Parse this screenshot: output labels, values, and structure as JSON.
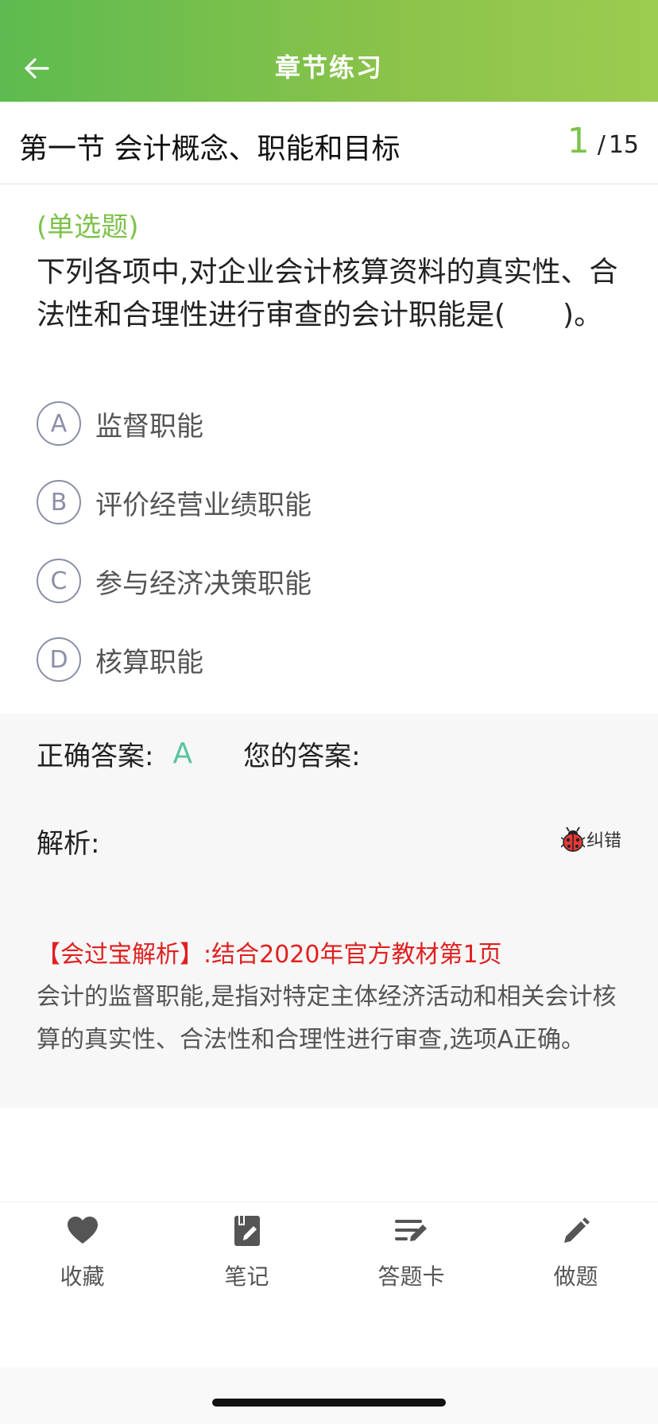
{
  "header": {
    "title": "章节练习"
  },
  "section": {
    "title": "第一节 会计概念、职能和目标",
    "current": "1",
    "separator": "/",
    "total": "15"
  },
  "question": {
    "type": "(单选题)",
    "text": "下列各项中,对企业会计核算资料的真实性、合法性和合理性进行审查的会计职能是(　　)。",
    "options": [
      {
        "letter": "A",
        "text": "监督职能"
      },
      {
        "letter": "B",
        "text": "评价经营业绩职能"
      },
      {
        "letter": "C",
        "text": "参与经济决策职能"
      },
      {
        "letter": "D",
        "text": "核算职能"
      }
    ]
  },
  "answer": {
    "correct_label": "正确答案:",
    "correct_value": "A",
    "yours_label": "您的答案:",
    "yours_value": "",
    "analysis_label": "解析:",
    "report_label": "纠错",
    "analysis_source": "【会过宝解析】:结合2020年官方教材第1页",
    "analysis_body": "会计的监督职能,是指对特定主体经济活动和相关会计核算的真实性、合法性和合理性进行审查,选项A正确。"
  },
  "toolbar": {
    "items": [
      {
        "label": "收藏",
        "icon": "heart-icon"
      },
      {
        "label": "笔记",
        "icon": "notebook-icon"
      },
      {
        "label": "答题卡",
        "icon": "answer-sheet-icon"
      },
      {
        "label": "做题",
        "icon": "pencil-icon"
      }
    ]
  },
  "colors": {
    "brand_green": "#7cc24a",
    "correct_green": "#5bc4a0",
    "analysis_red": "#e02020"
  }
}
